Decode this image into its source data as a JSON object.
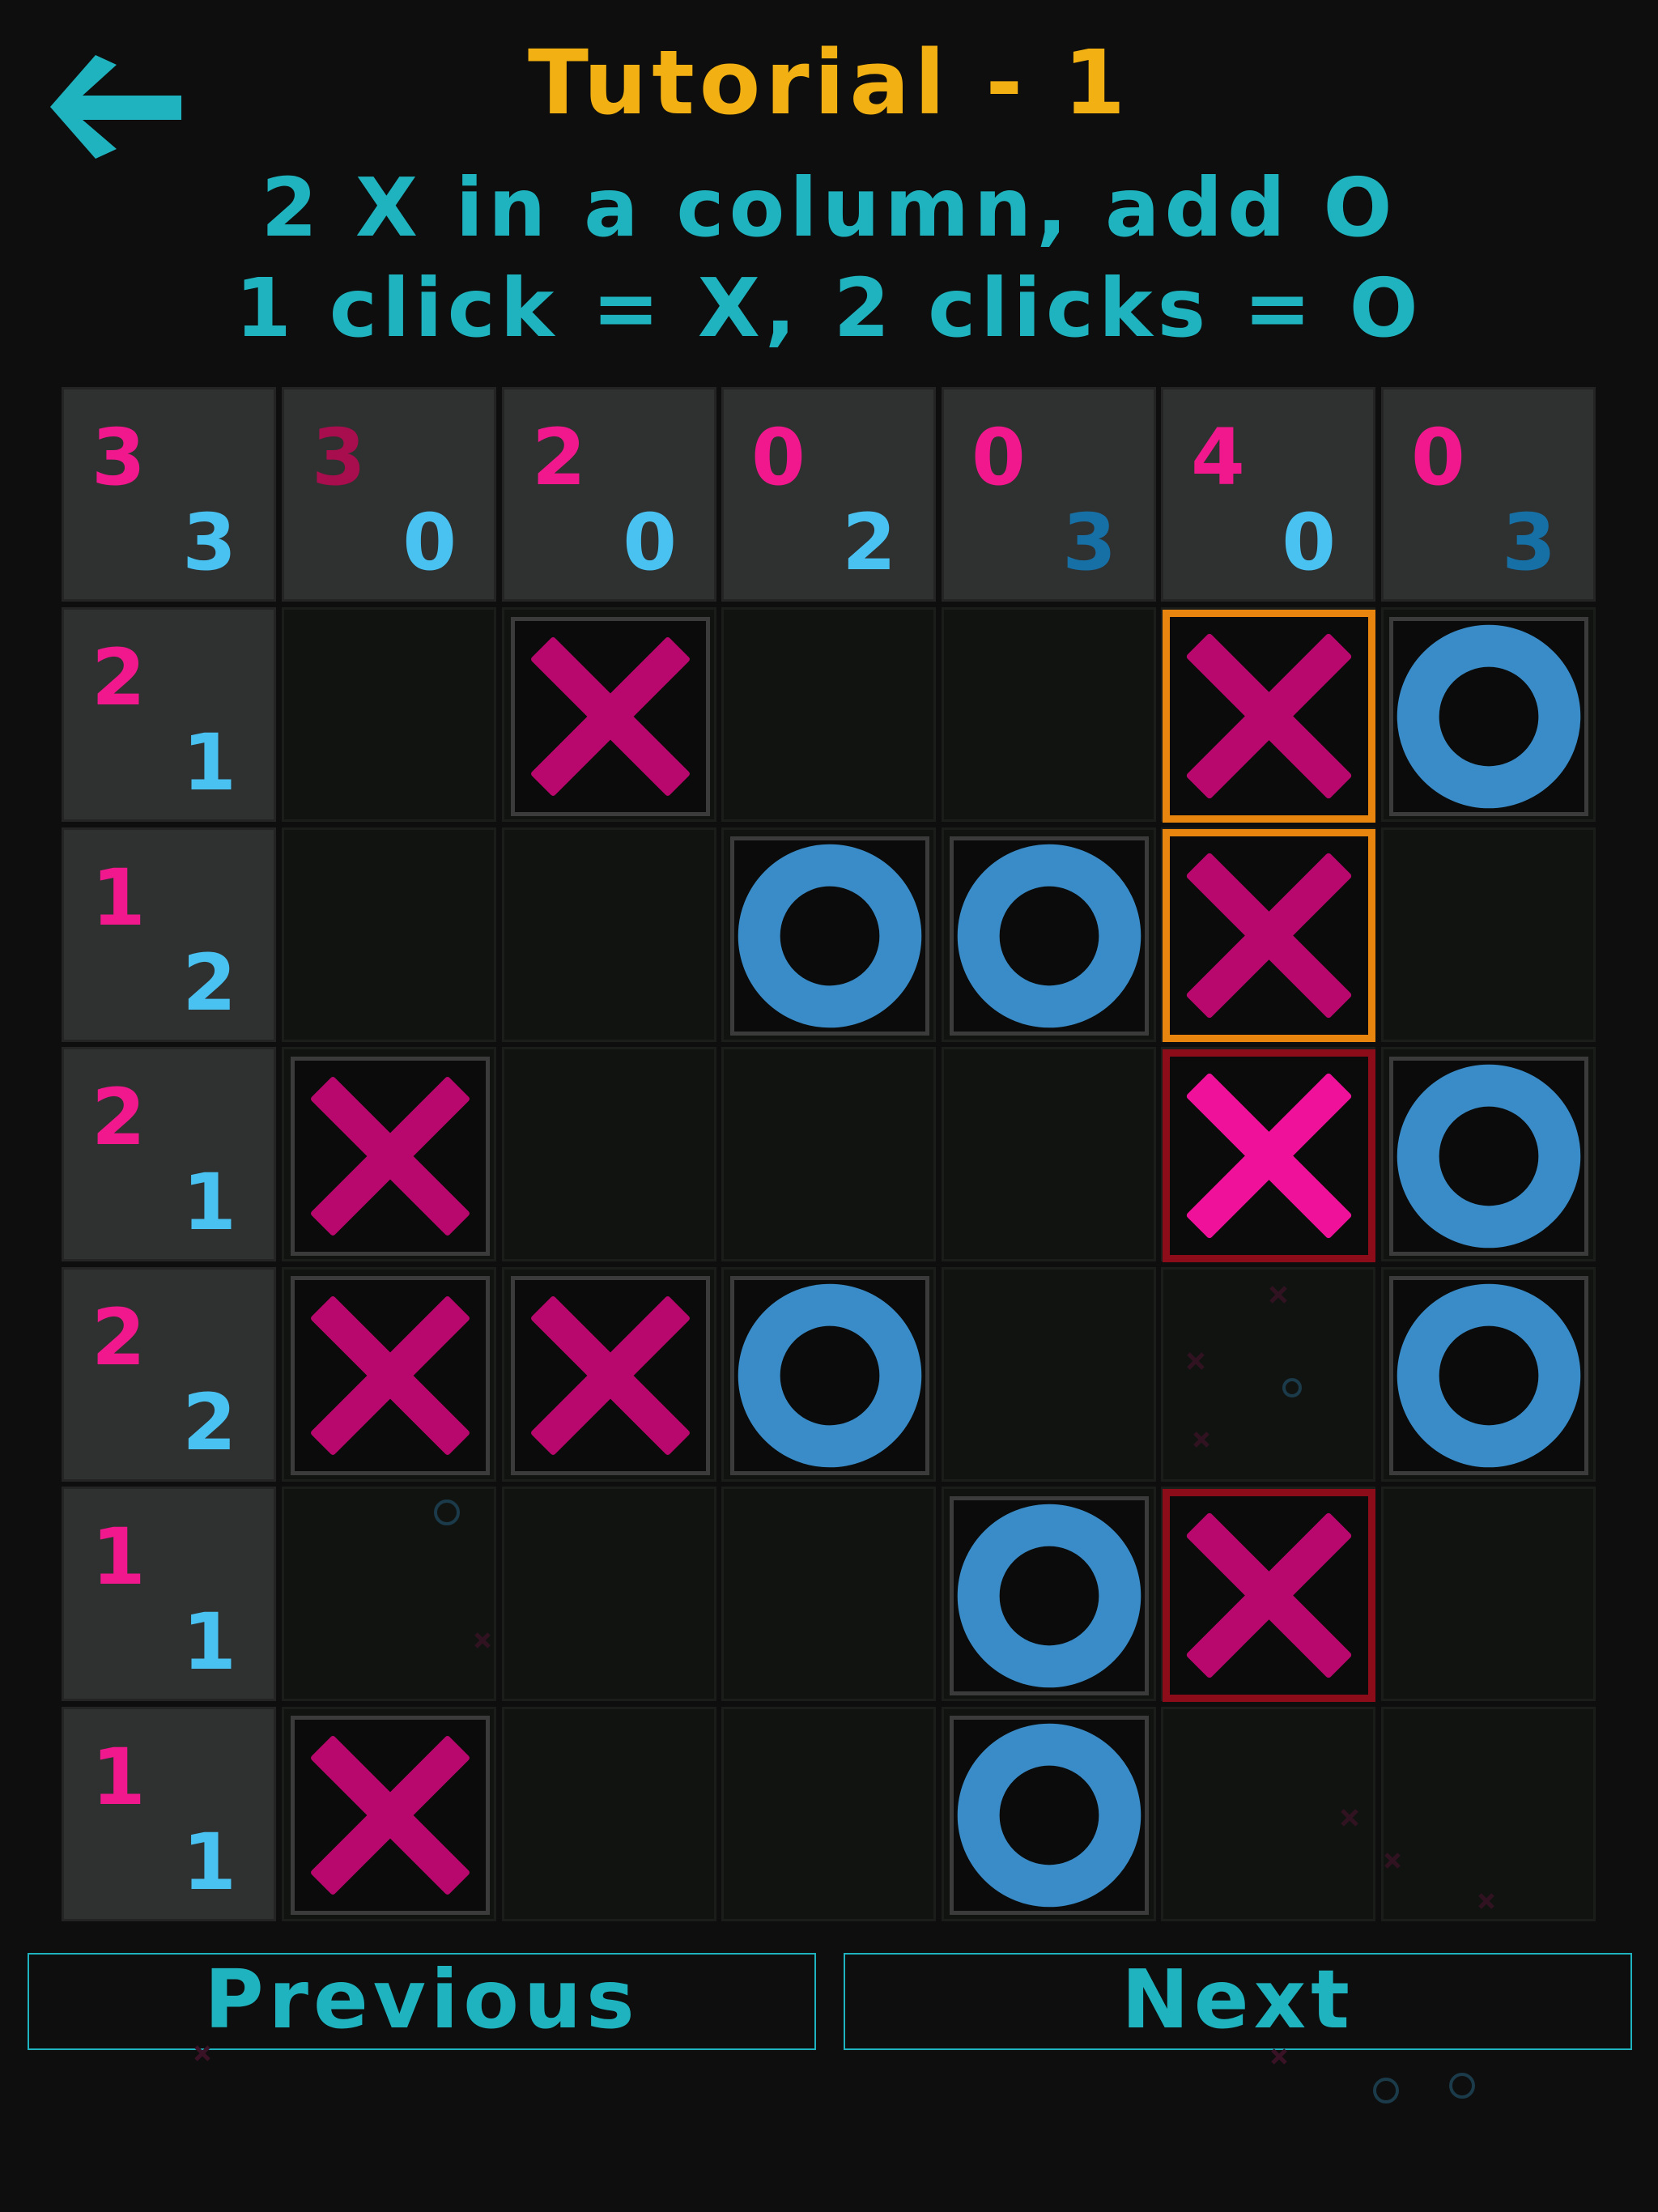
{
  "header": {
    "title": "Tutorial - 1",
    "instruction_line1": "2 X in a column, add O",
    "instruction_line2": "1 click = X, 2 clicks = O"
  },
  "colors": {
    "title": "#f2b013",
    "accent": "#1fb3bf",
    "x_mark": "#b8086e",
    "x_mark_active": "#f0119a",
    "o_mark": "#3a8cc8",
    "highlight_orange": "#e8850e",
    "highlight_red": "#8c0c1a"
  },
  "icons": {
    "back": "arrow-left-icon"
  },
  "board": {
    "corner": {
      "x_count": "3",
      "o_count": "3"
    },
    "column_headers": [
      {
        "x_count": "3",
        "o_count": "0"
      },
      {
        "x_count": "2",
        "o_count": "0"
      },
      {
        "x_count": "0",
        "o_count": "2"
      },
      {
        "x_count": "0",
        "o_count": "3"
      },
      {
        "x_count": "4",
        "o_count": "0"
      },
      {
        "x_count": "0",
        "o_count": "3"
      }
    ],
    "row_headers": [
      {
        "x_count": "2",
        "o_count": "1"
      },
      {
        "x_count": "1",
        "o_count": "2"
      },
      {
        "x_count": "2",
        "o_count": "1"
      },
      {
        "x_count": "2",
        "o_count": "2"
      },
      {
        "x_count": "1",
        "o_count": "1"
      },
      {
        "x_count": "1",
        "o_count": "1"
      }
    ],
    "grid": [
      [
        "",
        "X",
        "",
        "",
        "X",
        "O"
      ],
      [
        "",
        "",
        "O",
        "O",
        "X",
        ""
      ],
      [
        "X",
        "",
        "",
        "",
        "X",
        "O"
      ],
      [
        "X",
        "X",
        "O",
        "",
        "",
        "O"
      ],
      [
        "",
        "",
        "",
        "O",
        "X",
        ""
      ],
      [
        "X",
        "",
        "",
        "O",
        "",
        ""
      ]
    ]
  },
  "nav": {
    "previous_label": "Previous",
    "next_label": "Next"
  }
}
